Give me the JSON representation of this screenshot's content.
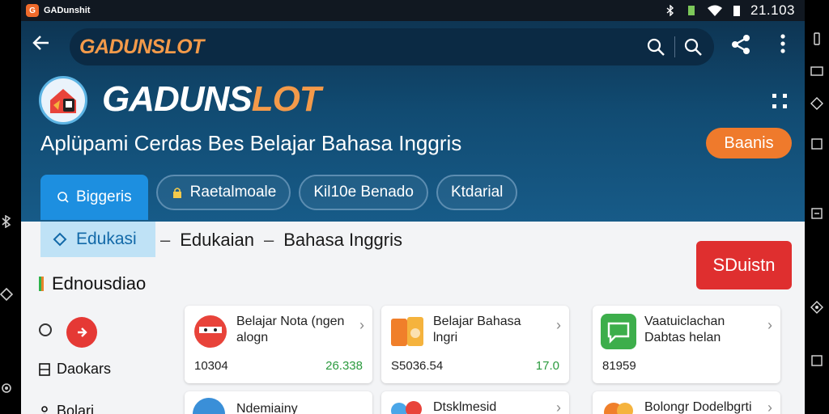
{
  "status": {
    "app_title": "GADunshit",
    "time": "21.103"
  },
  "search": {
    "title": "GADUNSLOT"
  },
  "header": {
    "brand_main": "GADUNS",
    "brand_accent": "LOT",
    "subtitle": "Aplüpami Cerdas Bes Belajar Bahasa Inggris",
    "orange_button": "Baanis"
  },
  "tabs": [
    {
      "label": "Biggeris",
      "icon": "search-icon"
    },
    {
      "label": "Raetalmoale",
      "icon": "lock-icon"
    },
    {
      "label": "Kil10e Benado",
      "icon": ""
    },
    {
      "label": "Ktdarial",
      "icon": ""
    }
  ],
  "breadcrumb": {
    "active": "Edukasi",
    "items": [
      "Edukaian",
      "Bahasa Inggris"
    ]
  },
  "red_button": "SDuistn",
  "section_title": "Ednousdiao",
  "sidebar": {
    "item1": "Daokars",
    "item2": "Bolari"
  },
  "cards": [
    {
      "title": "Belajar Nota (ngen alogn",
      "left": "10304",
      "right": "26.338",
      "icon": "ninja-icon"
    },
    {
      "title": "Belajar Bahasa lngri",
      "left": "S5036.54",
      "right": "17.0",
      "icon": "books-icon"
    },
    {
      "title": "Vaatuiclachan Dabtas helan",
      "left": "81959",
      "right": "",
      "icon": "chat-icon"
    },
    {
      "title": "Ndemiainy",
      "left": "",
      "right": "",
      "icon": "globe-icon"
    },
    {
      "title": "Dtsklmesid",
      "left": "",
      "right": "",
      "icon": "cloud-icon"
    },
    {
      "title": "Bolongr Dodelbgrti",
      "left": "",
      "right": "",
      "icon": "coin-icon"
    }
  ],
  "colors": {
    "header_top": "#0e3553",
    "accent_orange": "#ef7a2c",
    "tab_active": "#1d8fe0",
    "red": "#df2f2f",
    "green": "#2b9a3e"
  }
}
